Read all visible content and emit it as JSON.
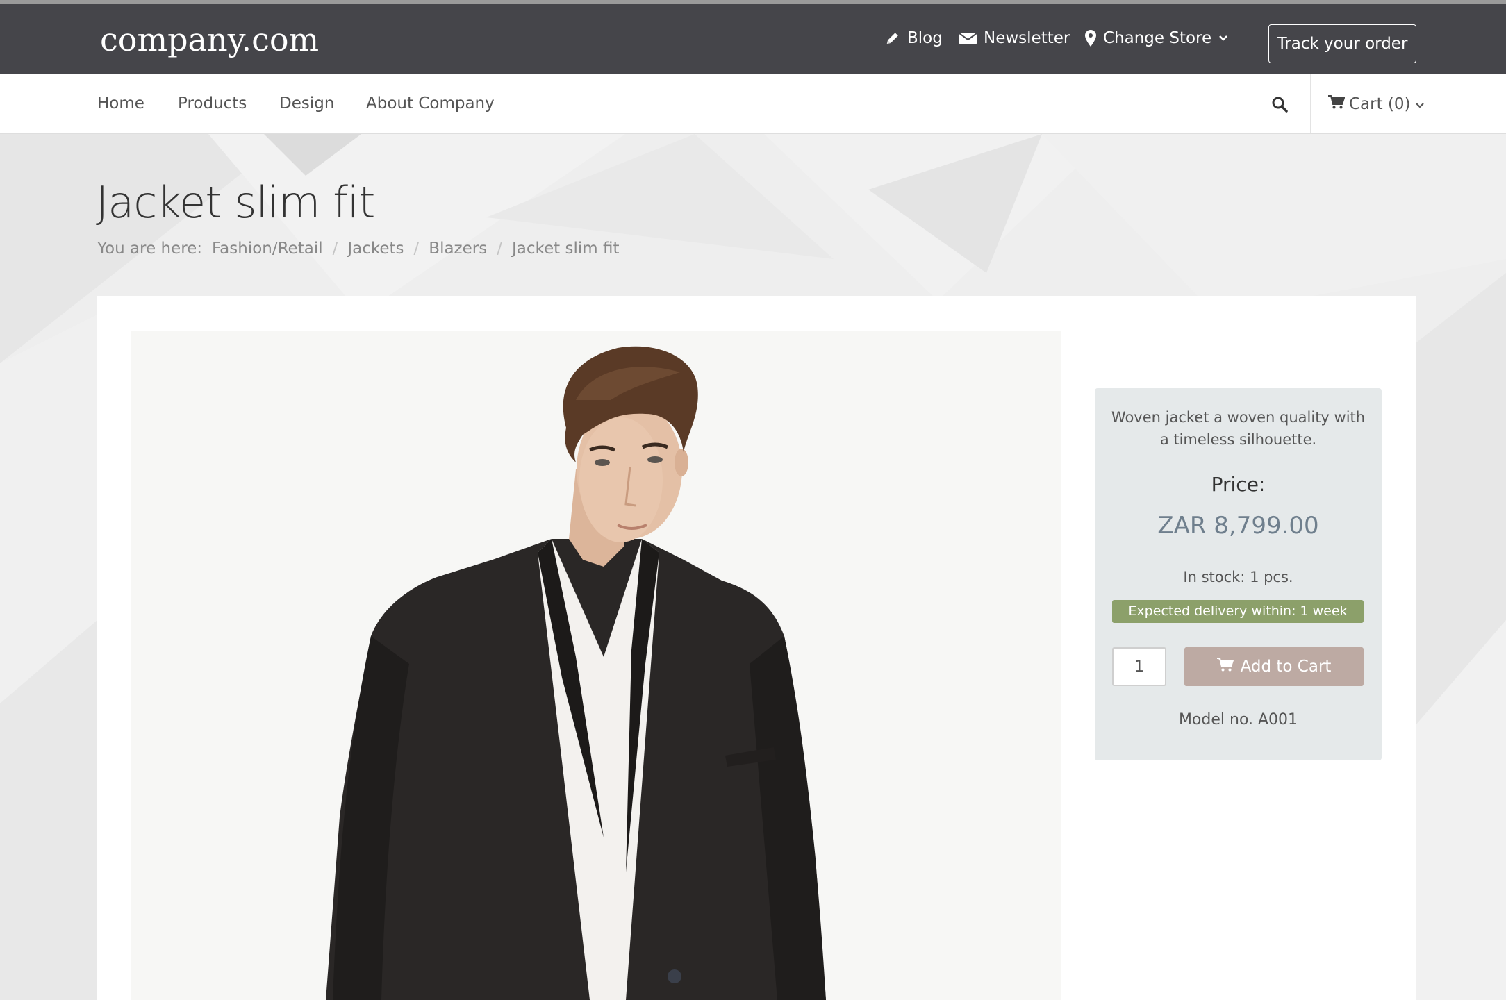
{
  "header": {
    "logo": "company.com",
    "links": {
      "blog": "Blog",
      "newsletter": "Newsletter",
      "change_store": "Change Store"
    },
    "track_order": "Track your order"
  },
  "nav": {
    "items": [
      "Home",
      "Products",
      "Design",
      "About Company"
    ],
    "cart": "Cart (0)"
  },
  "page": {
    "title": "Jacket slim fit",
    "breadcrumb_prefix": "You are here:",
    "breadcrumb": [
      "Fashion/Retail",
      "Jackets",
      "Blazers",
      "Jacket slim fit"
    ]
  },
  "product": {
    "description": "Woven jacket a woven quality with a timeless silhouette.",
    "price_label": "Price:",
    "price": "ZAR 8,799.00",
    "stock": "In stock: 1 pcs.",
    "delivery": "Expected delivery within: 1 week",
    "quantity": "1",
    "add_to_cart": "Add to Cart",
    "model": "Model no. A001"
  },
  "colors": {
    "topbar": "#45454a",
    "delivery_badge": "#8ca06a",
    "add_to_cart": "#bdaaa3",
    "price": "#6f7f8d",
    "info_box": "#e5e9ea"
  },
  "icons": {
    "blog": "pencil-icon",
    "newsletter": "envelope-icon",
    "store": "map-marker-icon",
    "search": "search-icon",
    "cart": "cart-icon"
  }
}
